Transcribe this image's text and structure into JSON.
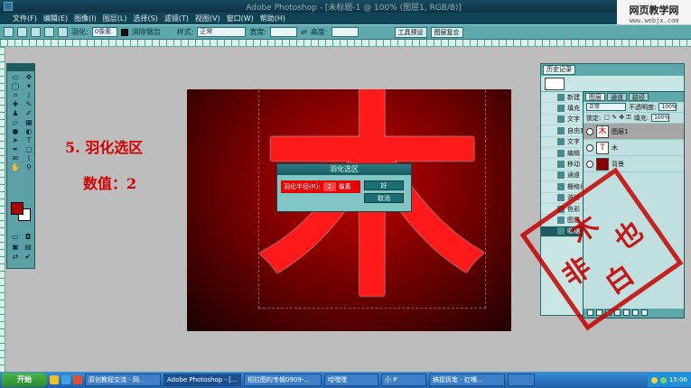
{
  "window": {
    "title": "Adobe Photoshop - [未标题-1 @ 100% (图层1, RGB/8)]"
  },
  "site_badge": {
    "line1": "网页教学网",
    "line2": "www.webjx.com"
  },
  "menu": [
    "文件(F)",
    "编辑(E)",
    "图像(I)",
    "图层(L)",
    "选择(S)",
    "滤镜(T)",
    "视图(V)",
    "窗口(W)",
    "帮助(H)"
  ],
  "options": {
    "feather_label": "羽化:",
    "feather_value": "0像素",
    "antialias_label": "消除锯齿",
    "style_label": "样式:",
    "style_value": "正常",
    "width_label": "宽度:",
    "height_label": "高度:",
    "tab_tools": "工具预设",
    "tab_layers": "图层复合"
  },
  "doc": {
    "step": "5. 羽化选区",
    "value_note": "数值：2",
    "glyph": "木"
  },
  "dialog": {
    "title": "羽化选区",
    "field_label": "羽化半径(R):",
    "field_value": "2",
    "unit": "像素",
    "ok": "好",
    "cancel": "取消"
  },
  "history": {
    "tab": "历史记录",
    "items": [
      "新建",
      "填充",
      "文字",
      "自由变换",
      "文字",
      "编辑",
      "移动",
      "通道",
      "栅格化",
      "波浪",
      "色彩",
      "图层",
      "收缩"
    ],
    "active_index": 12
  },
  "layers": {
    "tabs": [
      "图层",
      "通道",
      "路径"
    ],
    "blend_mode": "正常",
    "opacity_label": "不透明度:",
    "opacity_value": "100%",
    "lock_label": "锁定:",
    "fill_label": "填充:",
    "fill_value": "100%",
    "items": [
      {
        "name": "图层1",
        "thumb": "木"
      },
      {
        "name": "木",
        "thumb": "T"
      },
      {
        "name": "背景",
        "thumb": ""
      }
    ]
  },
  "stamp": {
    "glyphs": [
      "木",
      "非",
      "也",
      "白"
    ]
  },
  "taskbar": {
    "start": "开始",
    "tasks": [
      "原创教程交流 - 网...",
      "Adobe Photoshop - [...",
      "相拉图的专辑0909-...",
      "哈嘿嘿",
      "小 P",
      "搞捉拆笔 - 红嘴...",
      ""
    ],
    "clock": "15:06"
  },
  "colors": {
    "foreground": "#b00000",
    "background": "#ffffff",
    "stamp": "#c60000"
  }
}
